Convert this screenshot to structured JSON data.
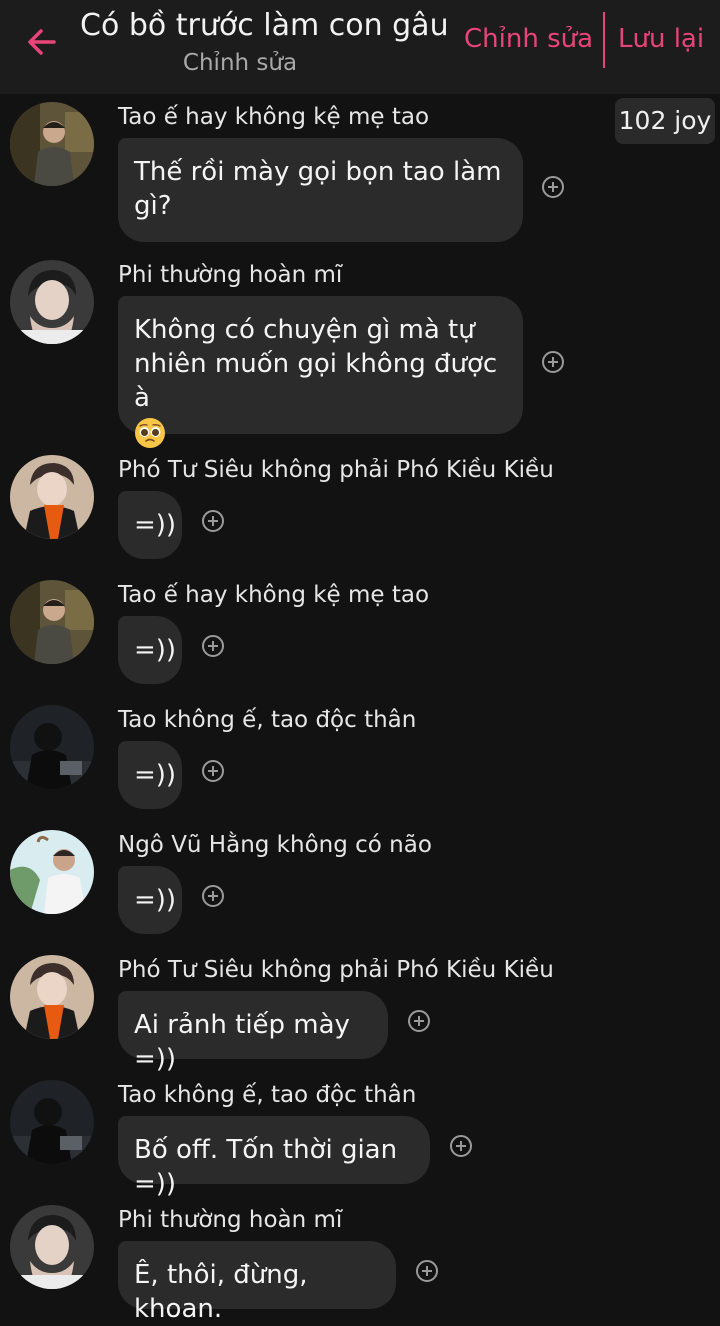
{
  "header": {
    "title": "Có bồ trước làm con gâu ...",
    "subtitle": "Chỉnh sửa",
    "edit_label": "Chỉnh sửa",
    "save_label": "Lưu lại"
  },
  "joy_badge": "102 joy",
  "messages": [
    {
      "name": "Tao ế hay không kệ mẹ tao",
      "text": "Thế rồi mày gọi bọn tao làm gì?"
    },
    {
      "name": "Phi thường hoàn mĩ",
      "text": "Không có chuyện gì mà tự nhiên muốn gọi không được à"
    },
    {
      "name": "Phó Tư Siêu không phải Phó Kiều Kiều",
      "text": "=))"
    },
    {
      "name": "Tao ế hay không kệ mẹ tao",
      "text": "=))"
    },
    {
      "name": "Tao không ế, tao độc thân",
      "text": "=))"
    },
    {
      "name": "Ngô Vũ Hằng không có não",
      "text": "=))"
    },
    {
      "name": "Phó Tư Siêu không phải Phó Kiều Kiều",
      "text": "Ai rảnh tiếp mày =))"
    },
    {
      "name": "Tao không ế, tao độc thân",
      "text": "Bố off. Tốn thời gian =))"
    },
    {
      "name": "Phi thường hoàn mĩ",
      "text": "Ê, thôi, đừng, khoan."
    }
  ],
  "icons": {
    "back": "arrow-left-icon",
    "add_reaction": "plus-circle-icon",
    "emoji": "pleading-face-emoji"
  },
  "colors": {
    "accent": "#e9447a",
    "background": "#121212",
    "header_bg": "#1c1c1c",
    "bubble_bg": "#2b2b2b"
  }
}
